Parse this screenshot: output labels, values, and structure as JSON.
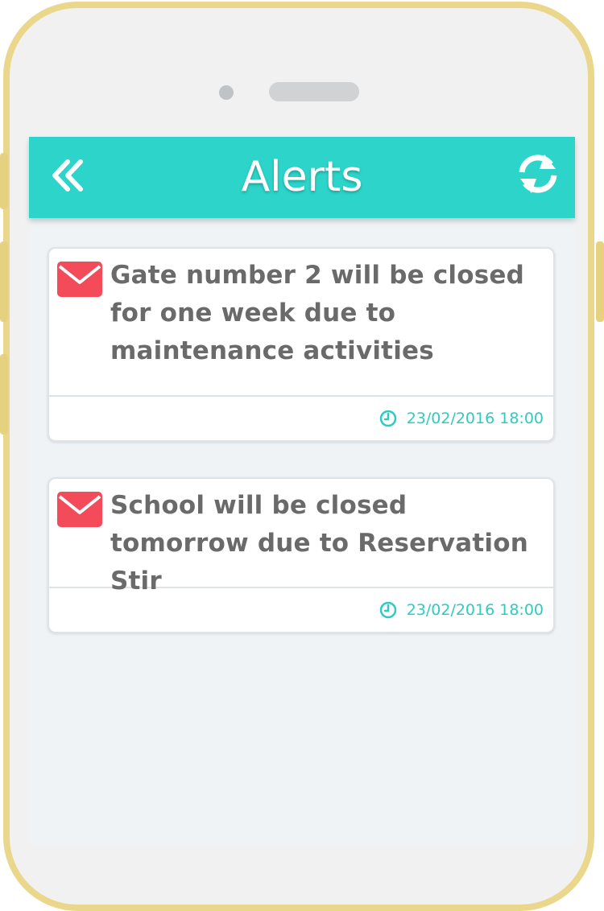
{
  "header": {
    "title": "Alerts",
    "back_icon": "double-chevron-left-icon",
    "refresh_icon": "refresh-icon",
    "accent_color": "#2dd4c9"
  },
  "alerts": [
    {
      "message": "Gate number 2 will be closed for one week due to maintenance activities",
      "timestamp": "23/02/2016 18:00",
      "icon": "envelope-icon",
      "icon_color": "#f44b5b"
    },
    {
      "message": "School will be closed tomorrow due to Reservation Stir",
      "timestamp": "23/02/2016 18:00",
      "icon": "envelope-icon",
      "icon_color": "#f44b5b"
    }
  ]
}
